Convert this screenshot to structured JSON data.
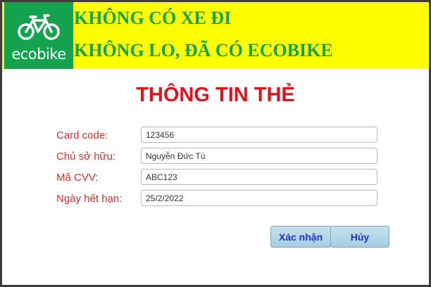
{
  "header": {
    "logo_text": "ecobike",
    "slogan_line1": "KHÔNG CÓ XE ĐI",
    "slogan_line2": "KHÔNG LO, ĐÃ CÓ ECOBIKE"
  },
  "form": {
    "title": "THÔNG TIN THẺ",
    "fields": [
      {
        "label": "Card code:",
        "value": "123456"
      },
      {
        "label": "Chủ sở hữu:",
        "value": "Nguyễn Đức Tú"
      },
      {
        "label": "Mã CVV:",
        "value": "ABC123"
      },
      {
        "label": "Ngày hết hạn:",
        "value": "25/2/2022"
      }
    ]
  },
  "buttons": {
    "confirm": "Xác nhận",
    "cancel": "Hủy"
  },
  "colors": {
    "brand_green": "#13a24e",
    "banner_yellow": "#ffff00",
    "title_red": "#e0121c",
    "label_red": "#d32f2f",
    "button_text": "#1f2fd0"
  }
}
